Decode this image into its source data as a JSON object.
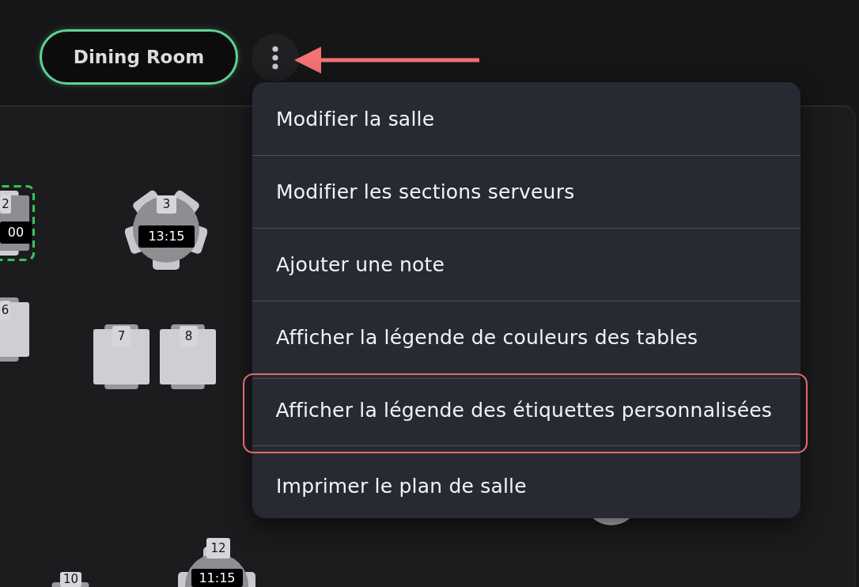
{
  "room_selector": {
    "label": "Dining Room",
    "selected": true
  },
  "floor_plan": {
    "tables": [
      {
        "kind": "square",
        "number": "2",
        "time": "00",
        "selected": true
      },
      {
        "kind": "round",
        "number": "3",
        "time": "13:15",
        "selected": false
      },
      {
        "kind": "square",
        "number": "6",
        "selected": false
      },
      {
        "kind": "square",
        "number": "7",
        "selected": false
      },
      {
        "kind": "square",
        "number": "8",
        "selected": false
      },
      {
        "kind": "round",
        "selected": false
      },
      {
        "kind": "square",
        "number": "10",
        "selected": false
      },
      {
        "kind": "round",
        "number": "12",
        "time": "11:15",
        "selected": false
      }
    ]
  },
  "menu": {
    "items": [
      {
        "label": "Modifier la salle",
        "highlighted": false
      },
      {
        "label": "Modifier les sections serveurs",
        "highlighted": false
      },
      {
        "label": "Ajouter une note",
        "highlighted": false
      },
      {
        "label": "Afficher la légende de couleurs des tables",
        "highlighted": false
      },
      {
        "label": "Afficher la légende des étiquettes personnalisées",
        "highlighted": true
      },
      {
        "label": "Imprimer le plan de salle",
        "highlighted": false
      }
    ]
  }
}
